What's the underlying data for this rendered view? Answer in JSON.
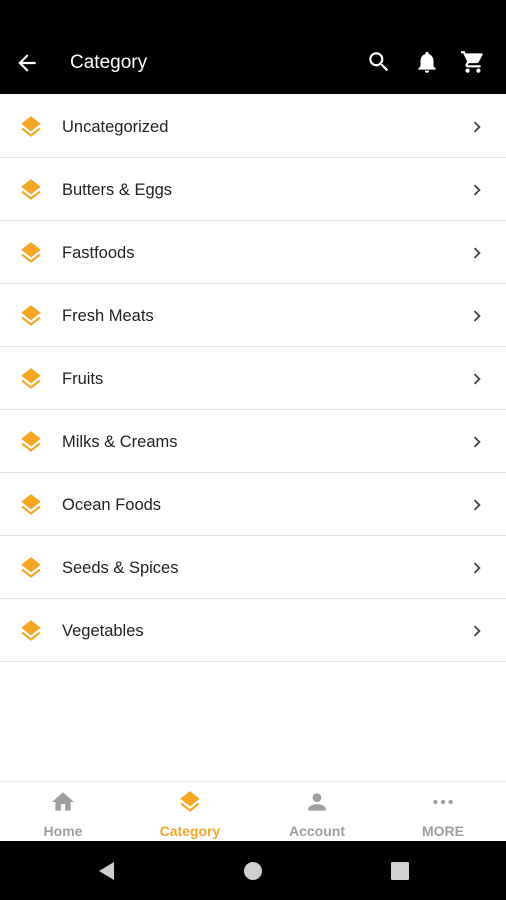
{
  "header": {
    "title": "Category",
    "icons": [
      "arrow-back-icon",
      "search-icon",
      "bell-icon",
      "cart-icon"
    ]
  },
  "categories": [
    {
      "label": "Uncategorized"
    },
    {
      "label": "Butters & Eggs"
    },
    {
      "label": "Fastfoods"
    },
    {
      "label": "Fresh Meats"
    },
    {
      "label": "Fruits"
    },
    {
      "label": "Milks & Creams"
    },
    {
      "label": "Ocean Foods"
    },
    {
      "label": "Seeds & Spices"
    },
    {
      "label": "Vegetables"
    }
  ],
  "bottom_nav": {
    "items": [
      {
        "label": "Home",
        "icon": "home-icon",
        "active": false
      },
      {
        "label": "Category",
        "icon": "layers-icon",
        "active": true
      },
      {
        "label": "Account",
        "icon": "person-icon",
        "active": false
      },
      {
        "label": "MORE",
        "icon": "more-dots-icon",
        "active": false
      }
    ]
  },
  "colors": {
    "accent": "#f5a623",
    "app_bar": "#000000",
    "inactive": "#9e9e9e"
  }
}
